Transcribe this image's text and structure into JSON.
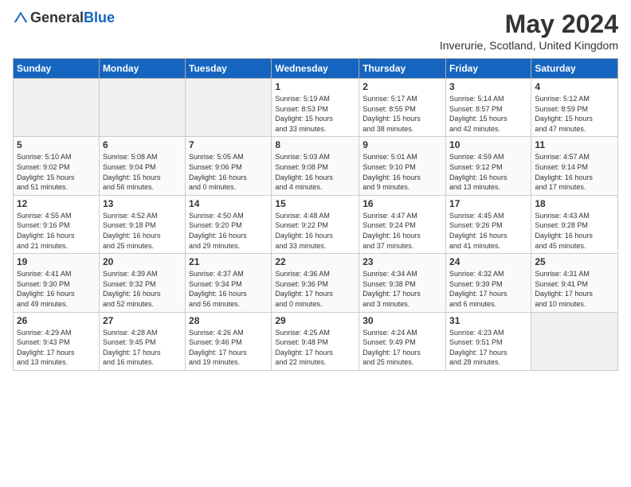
{
  "header": {
    "logo_general": "General",
    "logo_blue": "Blue",
    "title": "May 2024",
    "subtitle": "Inverurie, Scotland, United Kingdom"
  },
  "columns": [
    "Sunday",
    "Monday",
    "Tuesday",
    "Wednesday",
    "Thursday",
    "Friday",
    "Saturday"
  ],
  "weeks": [
    [
      {
        "day": "",
        "info": ""
      },
      {
        "day": "",
        "info": ""
      },
      {
        "day": "",
        "info": ""
      },
      {
        "day": "1",
        "info": "Sunrise: 5:19 AM\nSunset: 8:53 PM\nDaylight: 15 hours\nand 33 minutes."
      },
      {
        "day": "2",
        "info": "Sunrise: 5:17 AM\nSunset: 8:55 PM\nDaylight: 15 hours\nand 38 minutes."
      },
      {
        "day": "3",
        "info": "Sunrise: 5:14 AM\nSunset: 8:57 PM\nDaylight: 15 hours\nand 42 minutes."
      },
      {
        "day": "4",
        "info": "Sunrise: 5:12 AM\nSunset: 8:59 PM\nDaylight: 15 hours\nand 47 minutes."
      }
    ],
    [
      {
        "day": "5",
        "info": "Sunrise: 5:10 AM\nSunset: 9:02 PM\nDaylight: 15 hours\nand 51 minutes."
      },
      {
        "day": "6",
        "info": "Sunrise: 5:08 AM\nSunset: 9:04 PM\nDaylight: 15 hours\nand 56 minutes."
      },
      {
        "day": "7",
        "info": "Sunrise: 5:05 AM\nSunset: 9:06 PM\nDaylight: 16 hours\nand 0 minutes."
      },
      {
        "day": "8",
        "info": "Sunrise: 5:03 AM\nSunset: 9:08 PM\nDaylight: 16 hours\nand 4 minutes."
      },
      {
        "day": "9",
        "info": "Sunrise: 5:01 AM\nSunset: 9:10 PM\nDaylight: 16 hours\nand 9 minutes."
      },
      {
        "day": "10",
        "info": "Sunrise: 4:59 AM\nSunset: 9:12 PM\nDaylight: 16 hours\nand 13 minutes."
      },
      {
        "day": "11",
        "info": "Sunrise: 4:57 AM\nSunset: 9:14 PM\nDaylight: 16 hours\nand 17 minutes."
      }
    ],
    [
      {
        "day": "12",
        "info": "Sunrise: 4:55 AM\nSunset: 9:16 PM\nDaylight: 16 hours\nand 21 minutes."
      },
      {
        "day": "13",
        "info": "Sunrise: 4:52 AM\nSunset: 9:18 PM\nDaylight: 16 hours\nand 25 minutes."
      },
      {
        "day": "14",
        "info": "Sunrise: 4:50 AM\nSunset: 9:20 PM\nDaylight: 16 hours\nand 29 minutes."
      },
      {
        "day": "15",
        "info": "Sunrise: 4:48 AM\nSunset: 9:22 PM\nDaylight: 16 hours\nand 33 minutes."
      },
      {
        "day": "16",
        "info": "Sunrise: 4:47 AM\nSunset: 9:24 PM\nDaylight: 16 hours\nand 37 minutes."
      },
      {
        "day": "17",
        "info": "Sunrise: 4:45 AM\nSunset: 9:26 PM\nDaylight: 16 hours\nand 41 minutes."
      },
      {
        "day": "18",
        "info": "Sunrise: 4:43 AM\nSunset: 9:28 PM\nDaylight: 16 hours\nand 45 minutes."
      }
    ],
    [
      {
        "day": "19",
        "info": "Sunrise: 4:41 AM\nSunset: 9:30 PM\nDaylight: 16 hours\nand 49 minutes."
      },
      {
        "day": "20",
        "info": "Sunrise: 4:39 AM\nSunset: 9:32 PM\nDaylight: 16 hours\nand 52 minutes."
      },
      {
        "day": "21",
        "info": "Sunrise: 4:37 AM\nSunset: 9:34 PM\nDaylight: 16 hours\nand 56 minutes."
      },
      {
        "day": "22",
        "info": "Sunrise: 4:36 AM\nSunset: 9:36 PM\nDaylight: 17 hours\nand 0 minutes."
      },
      {
        "day": "23",
        "info": "Sunrise: 4:34 AM\nSunset: 9:38 PM\nDaylight: 17 hours\nand 3 minutes."
      },
      {
        "day": "24",
        "info": "Sunrise: 4:32 AM\nSunset: 9:39 PM\nDaylight: 17 hours\nand 6 minutes."
      },
      {
        "day": "25",
        "info": "Sunrise: 4:31 AM\nSunset: 9:41 PM\nDaylight: 17 hours\nand 10 minutes."
      }
    ],
    [
      {
        "day": "26",
        "info": "Sunrise: 4:29 AM\nSunset: 9:43 PM\nDaylight: 17 hours\nand 13 minutes."
      },
      {
        "day": "27",
        "info": "Sunrise: 4:28 AM\nSunset: 9:45 PM\nDaylight: 17 hours\nand 16 minutes."
      },
      {
        "day": "28",
        "info": "Sunrise: 4:26 AM\nSunset: 9:46 PM\nDaylight: 17 hours\nand 19 minutes."
      },
      {
        "day": "29",
        "info": "Sunrise: 4:25 AM\nSunset: 9:48 PM\nDaylight: 17 hours\nand 22 minutes."
      },
      {
        "day": "30",
        "info": "Sunrise: 4:24 AM\nSunset: 9:49 PM\nDaylight: 17 hours\nand 25 minutes."
      },
      {
        "day": "31",
        "info": "Sunrise: 4:23 AM\nSunset: 9:51 PM\nDaylight: 17 hours\nand 28 minutes."
      },
      {
        "day": "",
        "info": ""
      }
    ]
  ]
}
